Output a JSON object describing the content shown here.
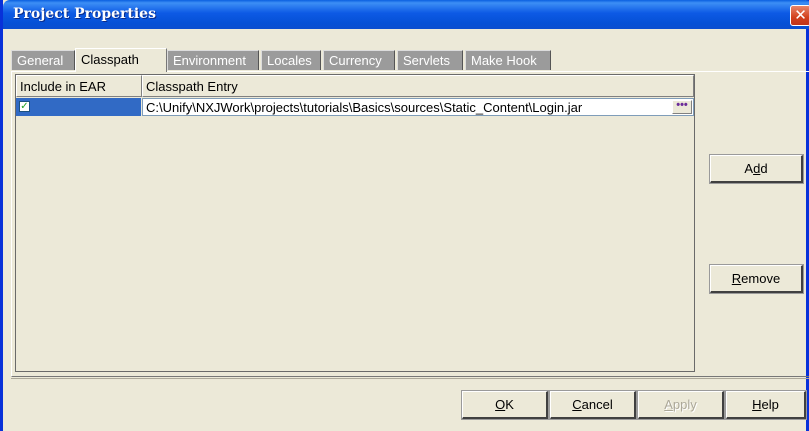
{
  "window": {
    "title": "Project Properties",
    "close_glyph": "✕"
  },
  "tabs": [
    {
      "label": "General",
      "active": false
    },
    {
      "label": "Classpath",
      "active": true
    },
    {
      "label": "Environment",
      "active": false
    },
    {
      "label": "Locales",
      "active": false
    },
    {
      "label": "Currency",
      "active": false
    },
    {
      "label": "Servlets",
      "active": false
    },
    {
      "label": "Make Hook",
      "active": false
    }
  ],
  "table": {
    "columns": [
      "Include in EAR",
      "Classpath Entry"
    ],
    "rows": [
      {
        "include": true,
        "entry": "C:\\Unify\\NXJWork\\projects\\tutorials\\Basics\\sources\\Static_Content\\Login.jar"
      }
    ],
    "checkbox_glyph": "✓",
    "ellipsis_glyph": "•••"
  },
  "side_buttons": {
    "add": {
      "pre": "A",
      "mnemonic": "d",
      "post": "d"
    },
    "remove": {
      "pre": "",
      "mnemonic": "R",
      "post": "emove"
    }
  },
  "footer_buttons": {
    "ok": {
      "pre": "",
      "mnemonic": "O",
      "post": "K",
      "enabled": true
    },
    "cancel": {
      "pre": "",
      "mnemonic": "C",
      "post": "ancel",
      "enabled": true
    },
    "apply": {
      "pre": "",
      "mnemonic": "A",
      "post": "pply",
      "enabled": false
    },
    "help": {
      "pre": "",
      "mnemonic": "H",
      "post": "elp",
      "enabled": true
    }
  },
  "colors": {
    "title_bar": "#0a5fe0",
    "selection": "#316ac5",
    "inactive_tab": "#9b9b9b",
    "dialog_bg": "#ece9d8"
  }
}
